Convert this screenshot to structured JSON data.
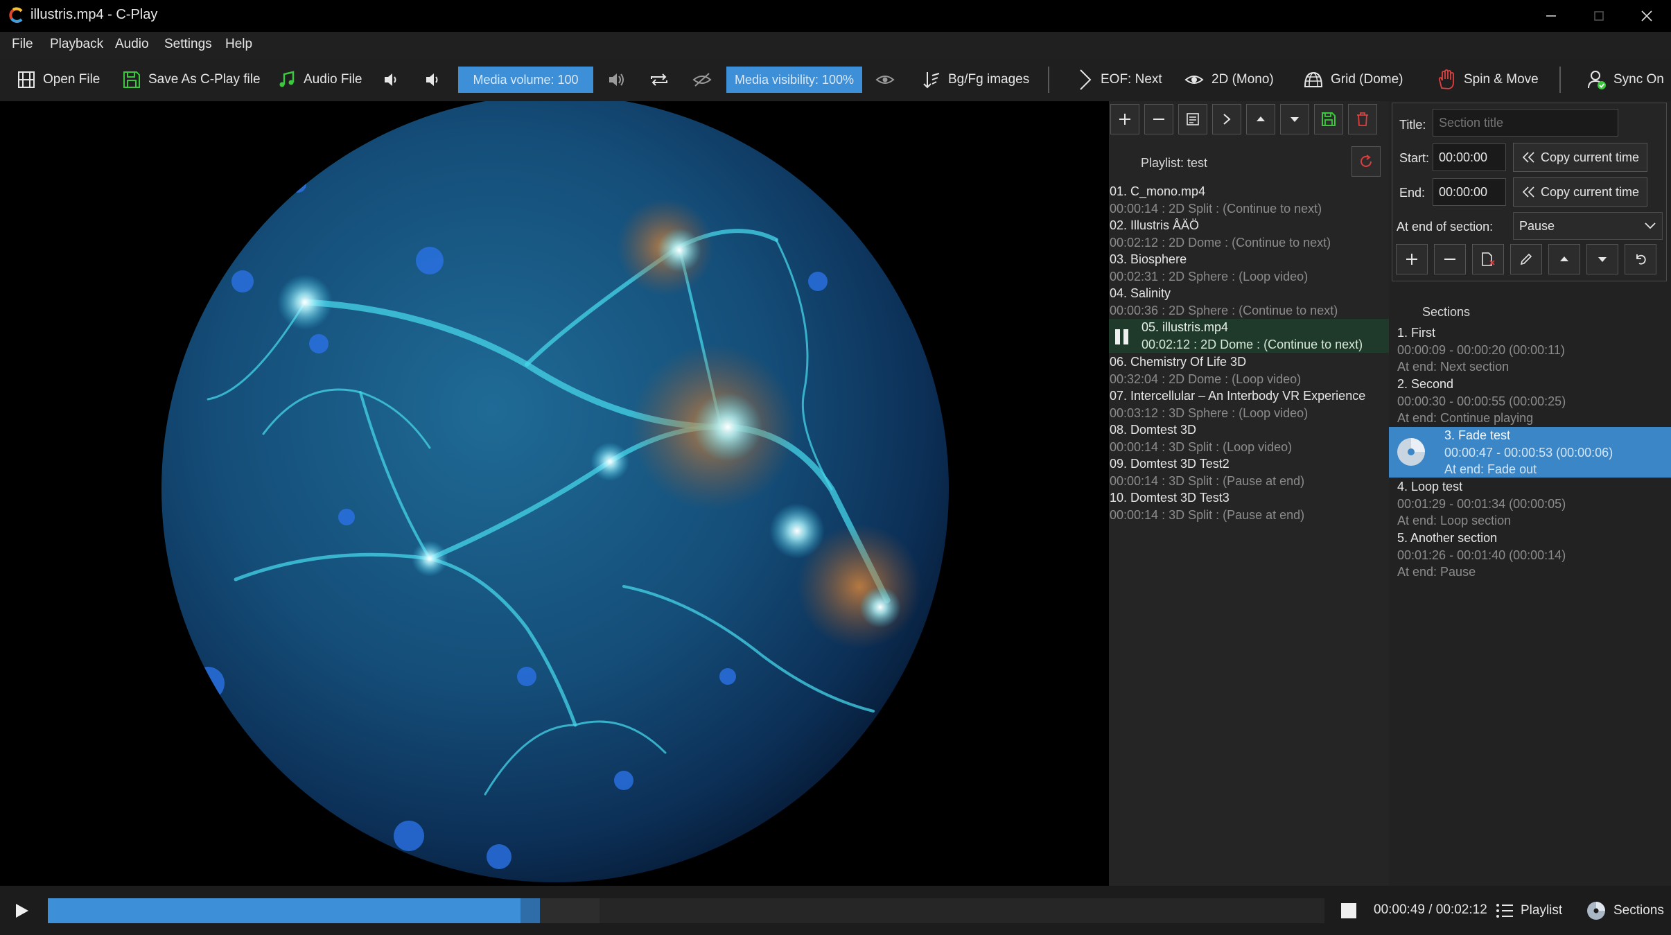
{
  "window": {
    "title": "illustris.mp4 - C-Play"
  },
  "menu": [
    "File",
    "Playback",
    "Audio",
    "Settings",
    "Help"
  ],
  "toolbar": {
    "open_file": "Open File",
    "save_as": "Save As C-Play file",
    "audio_file": "Audio File",
    "media_volume": "Media volume: 100",
    "media_visibility": "Media visibility: 100%",
    "bgfg_images": "Bg/Fg images",
    "eof": "EOF: Next",
    "mono": "2D (Mono)",
    "grid": "Grid (Dome)",
    "spin": "Spin & Move",
    "sync": "Sync On"
  },
  "playlist": {
    "title": "Playlist: test",
    "items": [
      {
        "name": "01. C_mono.mp4",
        "meta": "00:00:14 : 2D Split : (Continue to next)"
      },
      {
        "name": "02. Illustris ÅÄÖ",
        "meta": "00:02:12 : 2D Dome : (Continue to next)"
      },
      {
        "name": "03. Biosphere",
        "meta": "00:02:31 : 2D Sphere : (Loop video)"
      },
      {
        "name": "04. Salinity",
        "meta": "00:00:36 : 2D Sphere : (Continue to next)"
      },
      {
        "name": "05. illustris.mp4",
        "meta": "00:02:12 : 2D Dome : (Continue to next)"
      },
      {
        "name": "06. Chemistry Of Life 3D",
        "meta": "00:32:04 : 2D Dome : (Loop video)"
      },
      {
        "name": "07. Intercellular – An Interbody VR Experience",
        "meta": "00:03:12 : 3D Sphere : (Loop video)"
      },
      {
        "name": "08. Domtest 3D",
        "meta": "00:00:14 : 3D Split : (Loop video)"
      },
      {
        "name": "09. Domtest 3D Test2",
        "meta": "00:00:14 : 3D Split : (Pause at end)"
      },
      {
        "name": "10. Domtest 3D Test3",
        "meta": "00:00:14 : 3D Split : (Pause at end)"
      }
    ]
  },
  "section_editor": {
    "title_label": "Title:",
    "title_placeholder": "Section title",
    "start_label": "Start:",
    "start_value": "00:00:00",
    "end_label": "End:",
    "end_value": "00:00:00",
    "copy_time": "Copy current time",
    "at_end_label": "At end of section:",
    "at_end_value": "Pause"
  },
  "sections": {
    "title": "Sections",
    "items": [
      {
        "name": "1. First",
        "range": "00:00:09 - 00:00:20 (00:00:11)",
        "end": "At end: Next section"
      },
      {
        "name": "2. Second",
        "range": "00:00:30 - 00:00:55 (00:00:25)",
        "end": "At end: Continue playing"
      },
      {
        "name": "3. Fade test",
        "range": "00:00:47 - 00:00:53 (00:00:06)",
        "end": "At end: Fade out"
      },
      {
        "name": "4. Loop test",
        "range": "00:01:29 - 00:01:34 (00:00:05)",
        "end": "At end: Loop section"
      },
      {
        "name": "5. Another section",
        "range": "00:01:26 - 00:01:40 (00:00:14)",
        "end": "At end: Pause"
      }
    ]
  },
  "player": {
    "time": "00:00:49 / 00:02:12",
    "progress": 0.37,
    "buffered": 0.432,
    "playlist_button": "Playlist",
    "sections_button": "Sections"
  },
  "colors": {
    "accent": "#3d8fd8",
    "active_playlist_row": "#1f3a2a",
    "active_section_row": "#3b86c7",
    "save_green": "#3cc83c",
    "delete_red": "#d94040"
  }
}
